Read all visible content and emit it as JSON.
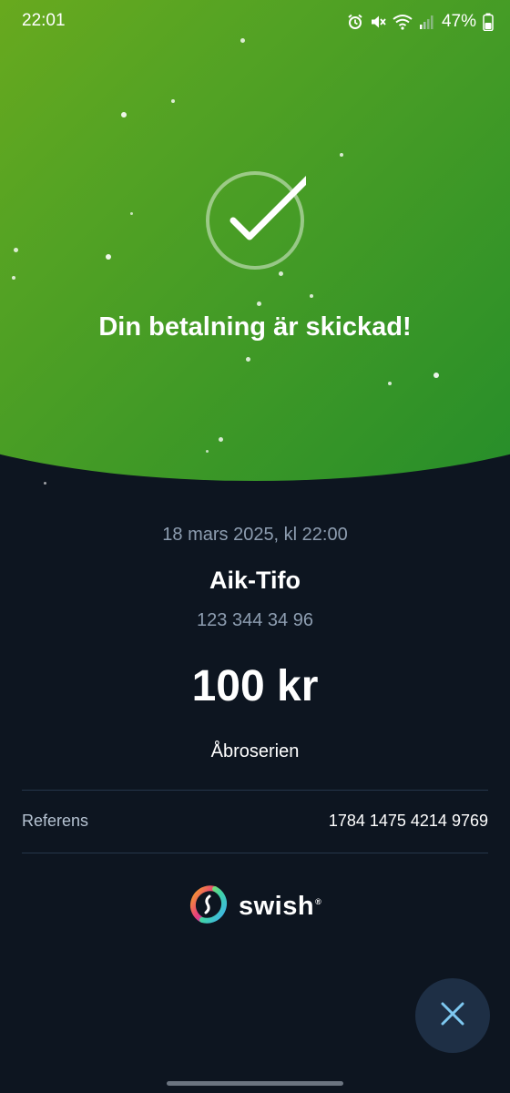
{
  "status_bar": {
    "time": "22:01",
    "battery": "47%",
    "icons": [
      "alarm-icon",
      "mute-icon",
      "wifi-icon",
      "signal-icon",
      "battery-icon"
    ]
  },
  "success": {
    "title": "Din betalning är skickad!",
    "icon": "checkmark-circle-icon"
  },
  "payment": {
    "date": "18 mars 2025, kl 22:00",
    "recipient_name": "Aik-Tifo",
    "recipient_number": "123 344 34 96",
    "amount": "100 kr",
    "message": "Åbroserien"
  },
  "reference": {
    "label": "Referens",
    "value": "1784 1475 4214 9769"
  },
  "brand": {
    "name": "swish",
    "reg_mark": "®"
  },
  "actions": {
    "close_icon": "close-icon"
  },
  "colors": {
    "hero_start": "#8cb414",
    "hero_end": "#1f8a2b",
    "background": "#0d1520",
    "muted_text": "#8d9db0",
    "close_button": "#1e2f45",
    "close_icon": "#7ec8f0"
  }
}
